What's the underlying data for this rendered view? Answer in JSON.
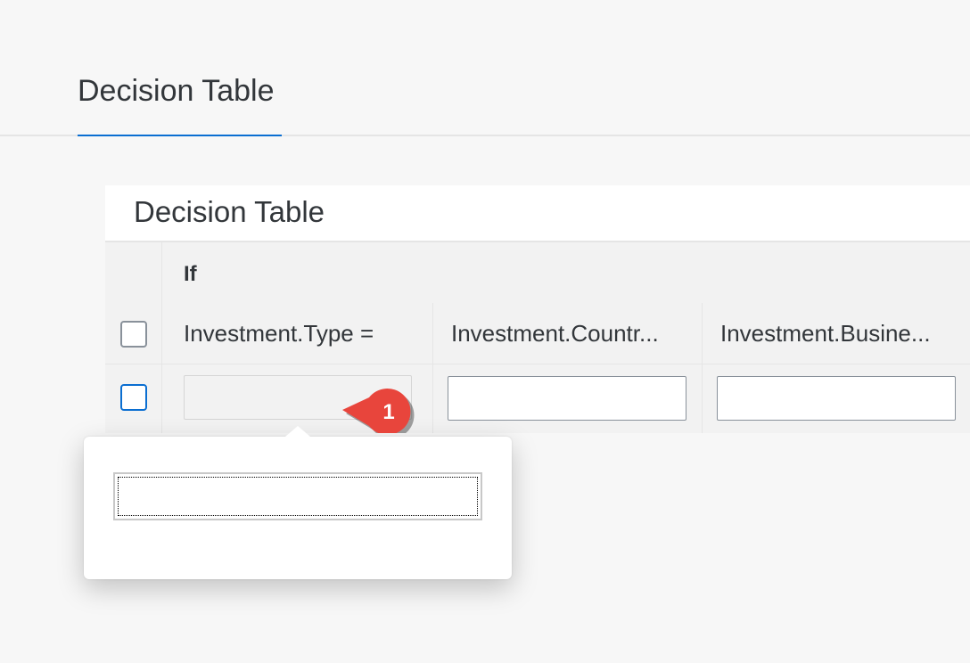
{
  "header": {
    "tab_title": "Decision Table"
  },
  "panel": {
    "title": "Decision Table",
    "group_label": "If",
    "columns": [
      {
        "label": "Investment.Type ="
      },
      {
        "label": "Investment.Countr..."
      },
      {
        "label": "Investment.Busine..."
      }
    ],
    "row": {
      "values": [
        "",
        "",
        ""
      ]
    }
  },
  "annotation": {
    "step_number": "1",
    "color": "#e8453c"
  },
  "popover": {
    "input_value": ""
  },
  "colors": {
    "accent": "#0a6ed1",
    "background": "#f7f7f7",
    "text": "#32363a"
  }
}
